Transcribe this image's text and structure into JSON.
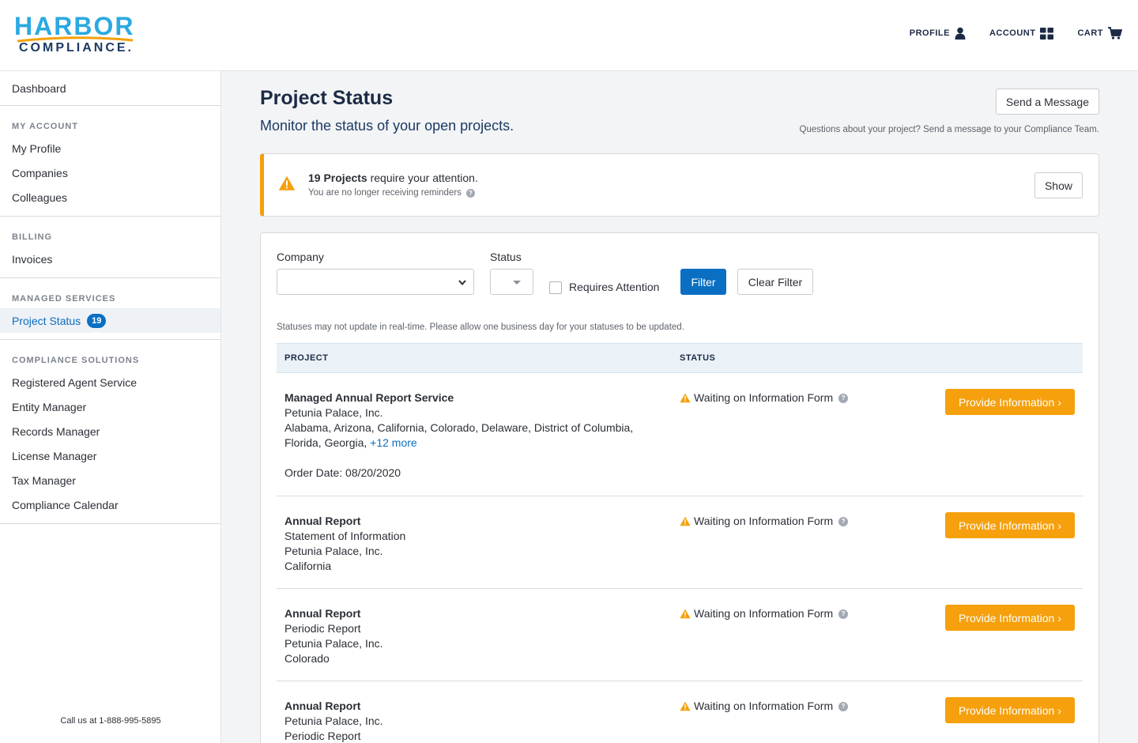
{
  "brand": {
    "word1": "HARBOR",
    "word2": "COMPLIANCE."
  },
  "topnav": {
    "profile": "PROFILE",
    "account": "ACCOUNT",
    "cart": "CART"
  },
  "sidebar": {
    "dashboard": "Dashboard",
    "groups": [
      {
        "heading": "MY ACCOUNT",
        "items": [
          "My Profile",
          "Companies",
          "Colleagues"
        ]
      },
      {
        "heading": "BILLING",
        "items": [
          "Invoices"
        ]
      },
      {
        "heading": "MANAGED SERVICES",
        "items": [
          "Project Status"
        ],
        "badge": "19"
      },
      {
        "heading": "COMPLIANCE SOLUTIONS",
        "items": [
          "Registered Agent Service",
          "Entity Manager",
          "Records Manager",
          "License Manager",
          "Tax Manager",
          "Compliance Calendar"
        ]
      }
    ],
    "footer": "Call us at 1-888-995-5895"
  },
  "page": {
    "title": "Project Status",
    "subtitle": "Monitor the status of your open projects.",
    "send_button": "Send a Message",
    "send_hint": "Questions about your project? Send a message to your Compliance Team."
  },
  "alert": {
    "count_text": "19 Projects",
    "rest_text": " require your attention.",
    "sub": "You are no longer receiving reminders",
    "show_button": "Show"
  },
  "filters": {
    "company_label": "Company",
    "company_value": "",
    "status_label": "Status",
    "requires_attention_label": "Requires Attention",
    "filter_button": "Filter",
    "clear_button": "Clear Filter",
    "note": "Statuses may not update in real-time. Please allow one business day for your statuses to be updated."
  },
  "table": {
    "headers": {
      "project": "PROJECT",
      "status": "STATUS"
    },
    "rows": [
      {
        "title": "Managed Annual Report Service",
        "line1": "Petunia Palace, Inc.",
        "line2": "Alabama, Arizona, California, Colorado, Delaware, District of Columbia,",
        "line3": "Florida, Georgia, ",
        "more": "+12 more",
        "order": "Order Date: 08/20/2020",
        "status": "Waiting on Information Form",
        "action": "Provide Information"
      },
      {
        "title": "Annual Report",
        "line1": "Statement of Information",
        "line2": "Petunia Palace, Inc.",
        "line3": "California",
        "status": "Waiting on Information Form",
        "action": "Provide Information"
      },
      {
        "title": "Annual Report",
        "line1": "Periodic Report",
        "line2": "Petunia Palace, Inc.",
        "line3": "Colorado",
        "status": "Waiting on Information Form",
        "action": "Provide Information"
      },
      {
        "title": "Annual Report",
        "line1": "Petunia Palace, Inc.",
        "line2": "Periodic Report",
        "status": "Waiting on Information Form",
        "action": "Provide Information"
      }
    ]
  },
  "colors": {
    "accent": "#0a6fc2",
    "warning": "#f5a00c",
    "brand_blue": "#2ba9e1",
    "brand_navy": "#1c3a63"
  }
}
